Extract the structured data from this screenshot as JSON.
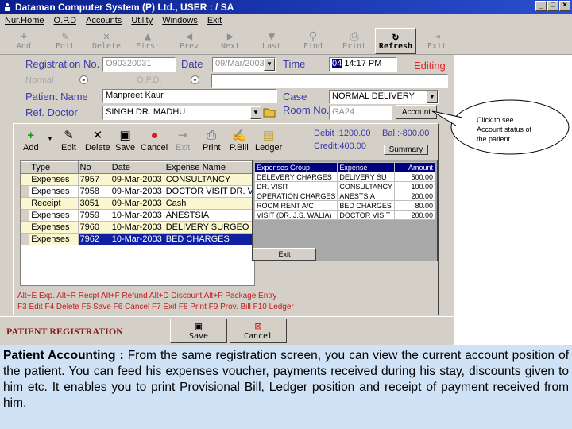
{
  "window": {
    "title": "Dataman Computer System (P) Ltd., USER : / SA",
    "buttons": [
      "_",
      "□",
      "×"
    ]
  },
  "menu": [
    "Nur.Home",
    "O.P.D",
    "Accounts",
    "Utility",
    "Windows",
    "Exit"
  ],
  "toolbar": [
    {
      "label": "Add",
      "icon": "+"
    },
    {
      "label": "Edit",
      "icon": "✎"
    },
    {
      "label": "Delete",
      "icon": "✕"
    },
    {
      "label": "First",
      "icon": "▲"
    },
    {
      "label": "Prev",
      "icon": "◀"
    },
    {
      "label": "Next",
      "icon": "▶"
    },
    {
      "label": "Last",
      "icon": "▼"
    },
    {
      "label": "Find",
      "icon": "⚲"
    },
    {
      "label": "Print",
      "icon": "⎙"
    },
    {
      "label": "Refresh",
      "icon": "↻"
    },
    {
      "label": "Exit",
      "icon": "⇥"
    }
  ],
  "form": {
    "registration_label": "Registration No.",
    "registration_value": "O90320031",
    "date_label": "Date",
    "date_value": "09/Mar/2003",
    "time_label": "Time",
    "time_value_sel": "04",
    "time_value": "14:17 PM",
    "status": "Editing",
    "normal_label": "Normal",
    "opd_label": "O.P.D.",
    "patient_label": "Patient Name",
    "patient_value": "Manpreet Kaur",
    "case_label": "Case",
    "case_value": "NORMAL DELIVERY",
    "doctor_label": "Ref. Doctor",
    "doctor_value": "SINGH DR. MADHU",
    "room_label": "Room No.",
    "room_value": "GA24",
    "account_button": "Account"
  },
  "inner_toolbar": [
    "Add",
    "Edit",
    "Delete",
    "Save",
    "Cancel",
    "Exit",
    "Print",
    "P.Bill",
    "Ledger"
  ],
  "summary": {
    "debit": "Debit :1200.00",
    "balance": "Bal.:-800.00",
    "credit": "Credit:400.00",
    "button": "Summary"
  },
  "voucher_table": {
    "headers": [
      "Type",
      "No",
      "Date",
      "Expense Name"
    ],
    "rows": [
      [
        "Expenses",
        "7957",
        "09-Mar-2003",
        "CONSULTANCY"
      ],
      [
        "Expenses",
        "7958",
        "09-Mar-2003",
        "DOCTOR VISIT DR. V"
      ],
      [
        "Receipt",
        "3051",
        "09-Mar-2003",
        "Cash"
      ],
      [
        "Expenses",
        "7959",
        "10-Mar-2003",
        "ANESTSIA"
      ],
      [
        "Expenses",
        "7960",
        "10-Mar-2003",
        "DELIVERY SURGEO"
      ],
      [
        "Expenses",
        "7962",
        "10-Mar-2003",
        "BED CHARGES"
      ]
    ]
  },
  "account_popup": {
    "headers": [
      "Expenses Group",
      "Expense",
      "Amount"
    ],
    "rows": [
      [
        "DELEVERY CHARGES",
        "DELIVERY SU",
        "500.00"
      ],
      [
        "DR. VISIT",
        "CONSULTANCY",
        "100.00"
      ],
      [
        "OPERATION CHARGES",
        "ANESTSIA",
        "200.00"
      ],
      [
        "ROOM RENT A/C",
        "BED CHARGES",
        "80.00"
      ],
      [
        "VISIT (DR. J.S. WALIA)",
        "DOCTOR VISIT",
        "200.00"
      ]
    ],
    "exit": "Exit"
  },
  "shortcuts": {
    "line1": "Alt+E Exp. Alt+R Recpt Alt+F Refund Alt+D Discount Alt+P Package Entry",
    "line2": "F3 Edit F4 Delete F5 Save F6 Cancel F7 Exit F8 Print F9 Prov. Bill F10 Ledger"
  },
  "footer": {
    "title": "PATIENT REGISTRATION",
    "save": "Save",
    "cancel": "Cancel"
  },
  "callout": "Click to see Account status of the patient",
  "description": {
    "heading": "Patient Accounting :",
    "body": "From the same registration screen, you can view the current account position of the patient. You can feed his expenses voucher, payments received during his stay, discounts given to him etc. It enables you to print Provisional Bill, Ledger position and receipt of payment received from him."
  },
  "colors": {
    "title_bar": "#0a1e8c",
    "label_blue": "#3a3aa8",
    "editing_red": "#e02020",
    "selection": "#1020a0",
    "description_bg": "#cfe2f6"
  }
}
